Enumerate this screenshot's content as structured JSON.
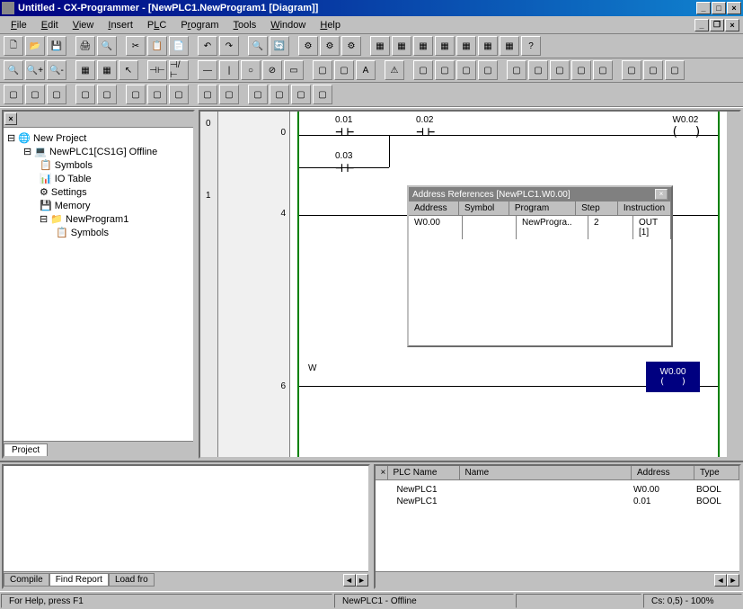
{
  "title": "Untitled - CX-Programmer - [NewPLC1.NewProgram1 [Diagram]]",
  "menu": {
    "file": "File",
    "edit": "Edit",
    "view": "View",
    "insert": "Insert",
    "plc": "PLC",
    "program": "Program",
    "tools": "Tools",
    "window": "Window",
    "help": "Help"
  },
  "tree": {
    "root": "New Project",
    "plc": "NewPLC1[CS1G] Offline",
    "items": [
      "Symbols",
      "IO Table",
      "Settings",
      "Memory"
    ],
    "program": "NewProgram1",
    "prog_child": "Symbols",
    "tab": "Project"
  },
  "ladder": {
    "rung_margins": [
      "0",
      "1"
    ],
    "step_nums": [
      "0",
      "4",
      "6"
    ],
    "contacts": {
      "c001": "0.01",
      "c002": "0.02",
      "c003": "0.03",
      "w002": "W0.02"
    },
    "coil_label": "W",
    "sel_coil": "W0.00"
  },
  "popup": {
    "title": "Address References [NewPLC1.W0.00]",
    "headers": [
      "Address",
      "Symbol",
      "Program",
      "Step",
      "Instruction"
    ],
    "row": {
      "address": "W0.00",
      "symbol": "",
      "program": "NewProgra..",
      "step": "2",
      "instruction": "OUT [1]"
    }
  },
  "bottom_left": {
    "tabs": [
      "Compile",
      "Find Report",
      "Load fro"
    ]
  },
  "bottom_right": {
    "headers": [
      "PLC Name",
      "Name",
      "Address",
      "Type"
    ],
    "rows": [
      {
        "plc": "NewPLC1",
        "name": "",
        "addr": "W0.00",
        "type": "BOOL"
      },
      {
        "plc": "NewPLC1",
        "name": "",
        "addr": "0.01",
        "type": "BOOL"
      }
    ]
  },
  "status": {
    "help": "For Help, press F1",
    "plc": "NewPLC1 - Offline",
    "coords": "Cs: 0,5) - 100%"
  }
}
